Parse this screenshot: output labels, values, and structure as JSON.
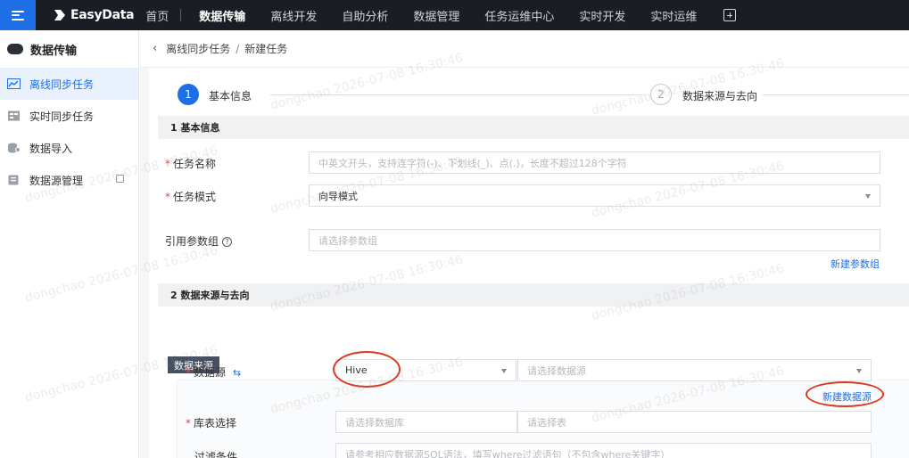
{
  "topbar": {
    "logo_text": "EasyData",
    "home": "首页",
    "nav": [
      {
        "label": "数据传输",
        "active": true
      },
      {
        "label": "离线开发",
        "active": false
      },
      {
        "label": "自助分析",
        "active": false
      },
      {
        "label": "数据管理",
        "active": false
      },
      {
        "label": "任务运维中心",
        "active": false
      },
      {
        "label": "实时开发",
        "active": false
      },
      {
        "label": "实时运维",
        "active": false
      }
    ]
  },
  "sidebar": {
    "title": "数据传输",
    "items": [
      {
        "label": "离线同步任务",
        "active": true,
        "icon": "chart-line-icon"
      },
      {
        "label": "实时同步任务",
        "active": false,
        "icon": "calendar-icon"
      },
      {
        "label": "数据导入",
        "active": false,
        "icon": "database-icon"
      },
      {
        "label": "数据源管理",
        "active": false,
        "icon": "document-icon"
      }
    ]
  },
  "breadcrumb": {
    "parent": "离线同步任务",
    "separator": "/",
    "current": "新建任务"
  },
  "steps": [
    {
      "index": "1",
      "label": "基本信息",
      "state": "active"
    },
    {
      "index": "2",
      "label": "数据来源与去向",
      "state": "inactive"
    }
  ],
  "basic": {
    "section_title": "1 基本信息",
    "task_name_label": "任务名称",
    "task_name_placeholder": "中英文开头，支持连字符(-)、下划线(_)、点(.)，长度不超过128个字符",
    "task_mode_label": "任务模式",
    "task_mode_value": "向导模式",
    "param_group_label": "引用参数组",
    "param_group_help": "?",
    "param_group_placeholder": "请选择参数组",
    "new_param_group": "新建参数组"
  },
  "source": {
    "section_title": "2 数据来源与去向",
    "tag": "数据来源",
    "datasource_label": "数据源",
    "datasource_type": "Hive",
    "datasource_placeholder": "请选择数据源",
    "new_datasource": "新建数据源",
    "table_label": "库表选择",
    "db_placeholder": "请选择数据库",
    "table_placeholder": "请选择表",
    "filter_label": "过滤条件",
    "filter_placeholder": "请参考相应数据源SQL语法，填写where过滤语句（不包含where关键字）"
  },
  "watermark": "dongchao 2026-07-08 16:30:46",
  "colors": {
    "accent": "#1e6fe6",
    "nav_bg": "#1b1d24",
    "annotation": "#d8391e",
    "required": "#e5484d"
  }
}
